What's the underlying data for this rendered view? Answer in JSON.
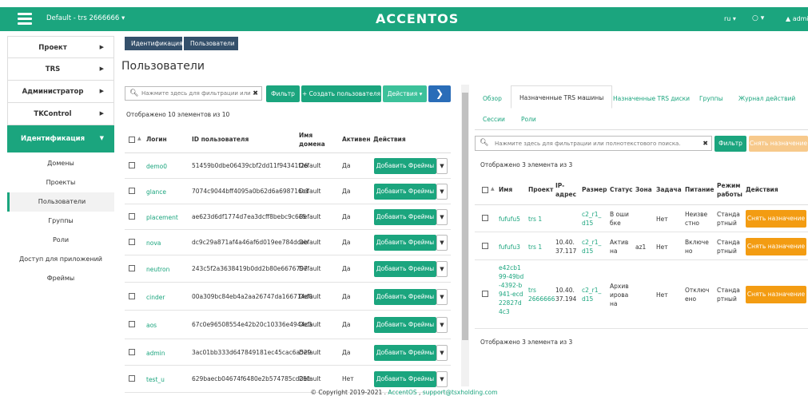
{
  "topbar": {
    "project": "Default - trs 2666666 ▾",
    "logo": "ACCENTOS",
    "lang": "ru ▾",
    "circle": "○ ▾",
    "user": "▲ admi"
  },
  "sidebar": {
    "main": [
      {
        "label": "Проект",
        "arrow": "▶"
      },
      {
        "label": "TRS",
        "arrow": "▶"
      },
      {
        "label": "Администратор",
        "arrow": "▶"
      },
      {
        "label": "TKControl",
        "arrow": "▶"
      },
      {
        "label": "Идентификация",
        "arrow": "▼"
      }
    ],
    "sub": [
      "Домены",
      "Проекты",
      "Пользователи",
      "Группы",
      "Роли",
      "Доступ для приложений",
      "Фреймы"
    ]
  },
  "breadcrumb": [
    "Идентификация",
    "Пользователи"
  ],
  "page_title": "Пользователи",
  "left": {
    "filter_placeholder": "Нажмите здесь для фильтрации или ...",
    "filter_btn": "Фильтр",
    "create_btn": "+ Создать пользователя",
    "actions_btn": "Действия ▾",
    "next_btn": "❯",
    "count": "Отображено 10 элементов из 10",
    "headers": {
      "sort": "▲",
      "login": "Логин",
      "id": "ID пользователя",
      "domain": "Имя домена",
      "active": "Активен",
      "actions": "Действия"
    },
    "add_label": "Добавить Фреймы",
    "rows": [
      {
        "login": "demo0",
        "id": "51459b0dbe06439cbf2dd11f94341f26",
        "domain": "Default",
        "active": "Да"
      },
      {
        "login": "glance",
        "id": "7074c9044bff4095a0b62d6a698716c1",
        "domain": "Default",
        "active": "Да"
      },
      {
        "login": "placement",
        "id": "ae623d6df1774d7ea3dcff8bebc9c6e5",
        "domain": "Default",
        "active": "Да"
      },
      {
        "login": "nova",
        "id": "dc9c29a871af4a46af6d019ee784dceb",
        "domain": "Default",
        "active": "Да"
      },
      {
        "login": "neutron",
        "id": "243c5f2a3638419b0dd2b80e6676797",
        "domain": "Default",
        "active": "Да"
      },
      {
        "login": "cinder",
        "id": "00a309bc84eb4a2aa26747da166714d0",
        "domain": "Default",
        "active": "Да"
      },
      {
        "login": "aos",
        "id": "67c0e96508554e42b20c10336e4944c3",
        "domain": "Default",
        "active": "Да"
      },
      {
        "login": "admin",
        "id": "3ac01bb333d647849181ec45cac6a529",
        "domain": "Default",
        "active": "Да"
      },
      {
        "login": "test_u",
        "id": "629baecb04674f6480e2b574785cd25b",
        "domain": "Default",
        "active": "Нет"
      }
    ]
  },
  "right": {
    "tabs": [
      "Обзор",
      "Назначенные TRS машины",
      "Назначенные TRS диски",
      "Группы",
      "Журнал действий",
      "Сессии",
      "Роли"
    ],
    "filter_placeholder": "Нажмите здесь для фильтрации или полнотекстового поиска.",
    "filter_btn": "Фильтр",
    "remove_btn": "Снять назначение",
    "count": "Отображено 3 элемента из 3",
    "headers": {
      "sort": "▲",
      "name": "Имя",
      "project": "Проект",
      "ip": "IP-адрес",
      "size": "Размер",
      "status": "Статус",
      "zone": "Зона",
      "task": "Задача",
      "power": "Питание",
      "mode": "Режим работы",
      "actions": "Действия"
    },
    "rows": [
      {
        "name": "fufufu5",
        "project": "trs 1",
        "ip": "",
        "size": "c2_r1_d15",
        "status": "В ошибке",
        "zone": "",
        "task": "Нет",
        "power": "Неизвестно",
        "mode": "Стандартный"
      },
      {
        "name": "fufufu3",
        "project": "trs 1",
        "ip": "10.40.37.117",
        "size": "c2_r1_d15",
        "status": "Активна",
        "zone": "az1",
        "task": "Нет",
        "power": "Включено",
        "mode": "Стандартный"
      },
      {
        "name": "e42cb199-49bd-4392-b941-ecd22827d4c3",
        "project": "trs 2666666",
        "ip": "10.40.37.194",
        "size": "c2_r1_d15",
        "status": "Архивирована",
        "zone": "",
        "task": "Нет",
        "power": "Отключено",
        "mode": "Стандартный"
      }
    ]
  },
  "footer": {
    "text": "© Copyright 2019-2021 . ",
    "link1": "AccentOS",
    "sep": " , ",
    "link2": "support@tsxholding.com"
  }
}
